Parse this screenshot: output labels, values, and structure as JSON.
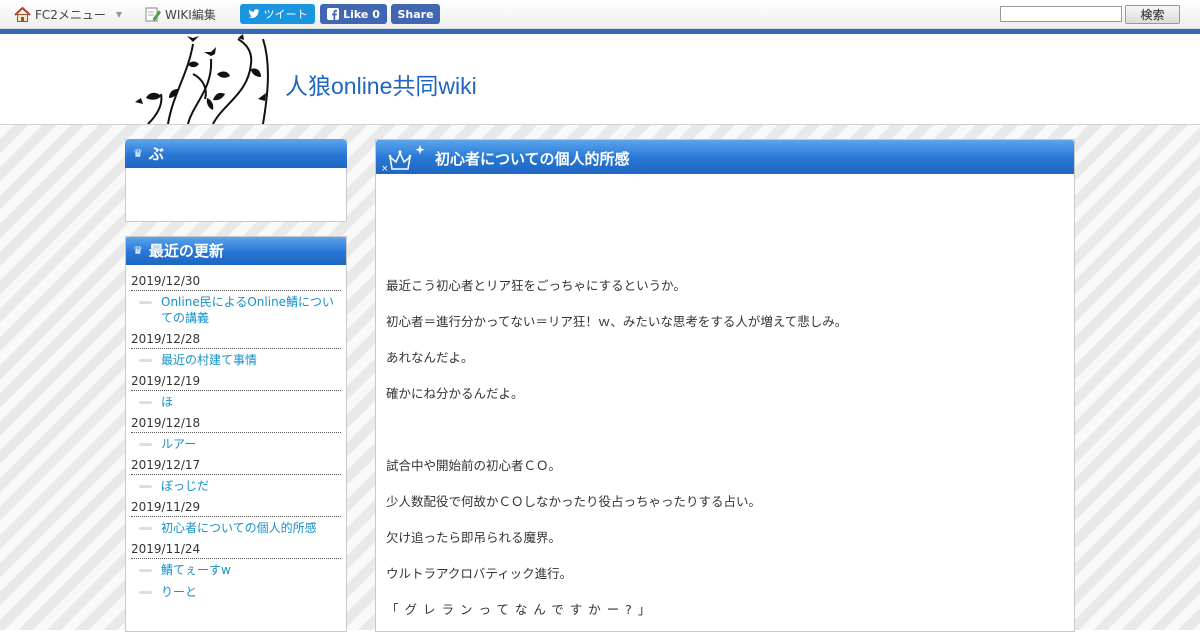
{
  "topbar": {
    "fc2_menu_label": "FC2メニュー",
    "wiki_edit_label": "WIKI編集",
    "tweet_label": "ツイート",
    "fb_like_label": "Like 0",
    "fb_share_label": "Share",
    "search_button_label": "検索",
    "search_value": ""
  },
  "header": {
    "site_title": "人狼online共同wiki"
  },
  "sidebar": {
    "box1_title": "ぶ",
    "updates_title": "最近の更新",
    "updates": [
      {
        "date": "2019/12/30",
        "items": [
          "Online民によるOnline鯖についての講義"
        ]
      },
      {
        "date": "2019/12/28",
        "items": [
          "最近の村建て事情"
        ]
      },
      {
        "date": "2019/12/19",
        "items": [
          "ほ"
        ]
      },
      {
        "date": "2019/12/18",
        "items": [
          "ルアー"
        ]
      },
      {
        "date": "2019/12/17",
        "items": [
          "ぼっじだ"
        ]
      },
      {
        "date": "2019/11/29",
        "items": [
          "初心者についての個人的所感"
        ]
      },
      {
        "date": "2019/11/24",
        "items": [
          "鯖てぇーすw",
          "りーと"
        ]
      }
    ]
  },
  "main": {
    "title": "初心者についての個人的所感",
    "paragraphs": [
      "最近こう初心者とリア狂をごっちゃにするというか。",
      "初心者＝進行分かってない＝リア狂！ｗ、みたいな思考をする人が増えて悲しみ。",
      "あれなんだよ。",
      "確かにね分かるんだよ。",
      "",
      "試合中や開始前の初心者ＣＯ。",
      "少人数配役で何故かＣＯしなかったり役占っちゃったりする占い。",
      "欠け追ったら即吊られる魔界。",
      "ウルトラアクロバティック進行。",
      "「グレランってなんですかー?」"
    ]
  },
  "colors": {
    "accent": "#1f66c2",
    "link": "#1591c9",
    "twitter": "#1b95e0",
    "facebook": "#4267b2"
  },
  "icons": [
    "home-icon",
    "edit-icon",
    "twitter-bird-icon",
    "facebook-icon",
    "crown-icon"
  ]
}
